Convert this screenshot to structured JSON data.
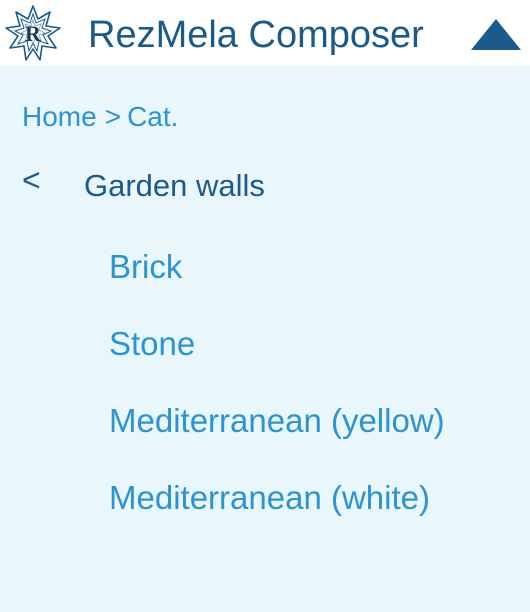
{
  "app": {
    "title": "RezMela Composer",
    "logo_icon": "star-logo-icon",
    "collapse_icon": "triangle-up-icon"
  },
  "breadcrumb": {
    "home": "Home",
    "separator": ">",
    "current": "Cat."
  },
  "category": {
    "back_label": "<",
    "title": "Garden walls"
  },
  "items": [
    {
      "label": "Brick"
    },
    {
      "label": "Stone"
    },
    {
      "label": "Mediterranean (yellow)"
    },
    {
      "label": "Mediterranean (white)"
    }
  ],
  "colors": {
    "background": "#e9f7fc",
    "header": "#ffffff",
    "dark_blue": "#1a5a8c",
    "link_blue": "#2b93d6"
  }
}
